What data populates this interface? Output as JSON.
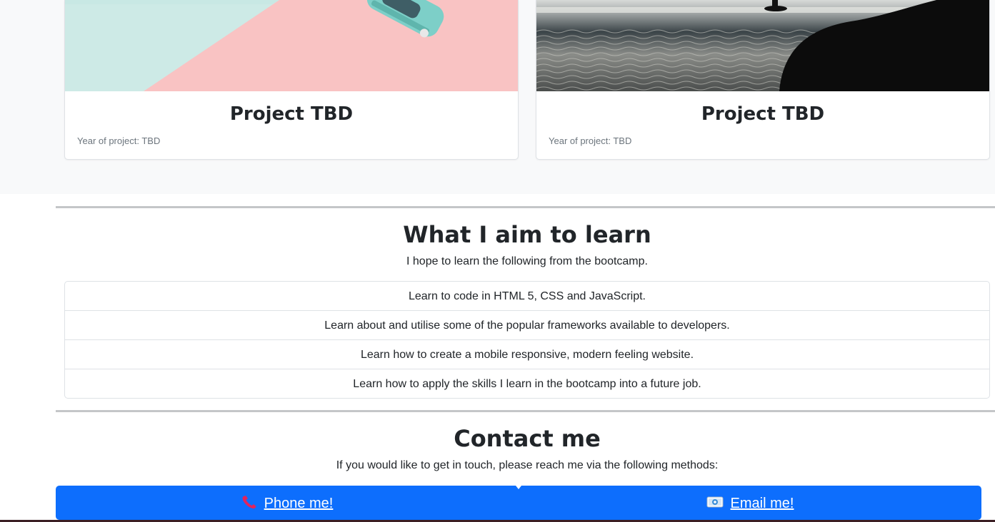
{
  "projects": [
    {
      "title": "Project TBD",
      "year_text": "Year of project: TBD",
      "image": "pastel-toy-car-photo"
    },
    {
      "title": "Project TBD",
      "year_text": "Year of project: TBD",
      "image": "surfer-ocean-photo"
    }
  ],
  "learn": {
    "title": "What I aim to learn",
    "lead": "I hope to learn the following from the bootcamp.",
    "items": [
      "Learn to code in HTML 5, CSS and JavaScript.",
      "Learn about and utilise some of the popular frameworks available to developers.",
      "Learn how to create a mobile responsive, modern feeling website.",
      "Learn how to apply the skills I learn in the bootcamp into a future job."
    ]
  },
  "contact": {
    "title": "Contact me",
    "lead": "If you would like to get in touch, please reach me via the following methods:",
    "phone_label": "Phone me!",
    "phone_icon": "telephone-receiver-icon",
    "email_label": "Email me!",
    "email_icon": "email-envelope-icon"
  },
  "colors": {
    "primary": "#0d6efd",
    "section_bg": "#f8f9fa",
    "muted_text": "#6c757d"
  }
}
